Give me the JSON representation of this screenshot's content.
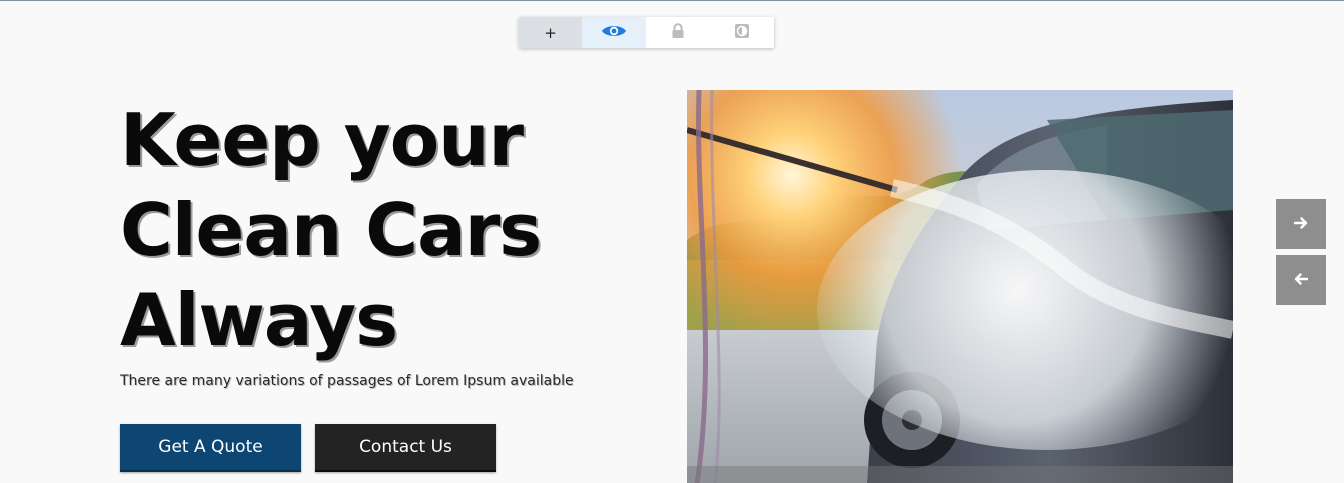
{
  "toolbar": {
    "add_label": "+",
    "buttons": [
      {
        "name": "add",
        "icon": "plus-icon"
      },
      {
        "name": "view",
        "icon": "eye-icon",
        "color": "#1e7be0"
      },
      {
        "name": "lock",
        "icon": "lock-icon",
        "color": "#b9bcc1"
      },
      {
        "name": "mode",
        "icon": "contrast-icon",
        "color": "#b9bcc1"
      }
    ]
  },
  "hero": {
    "headline_lines": [
      "Keep your",
      "Clean Cars",
      "Always"
    ],
    "subtext": "There are many variations of passages of Lorem Ipsum available",
    "buttons": {
      "quote_label": "Get A Quote",
      "contact_label": "Contact Us"
    },
    "image": {
      "subject": "car-wash-photo"
    }
  },
  "slider": {
    "next_icon": "arrow-right-icon",
    "prev_icon": "arrow-left-icon"
  },
  "colors": {
    "quote_button": "#0d4673",
    "contact_button": "#232323",
    "arrow_bg": "#8e8e8e",
    "background": "#f9f9f9"
  }
}
